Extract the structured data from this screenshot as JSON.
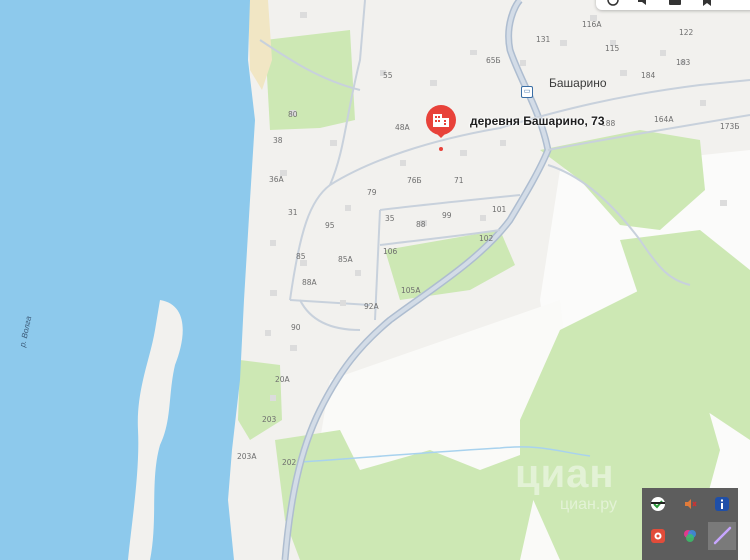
{
  "map": {
    "water_color": "#8dc9ec",
    "land_color": "#f2f1ee",
    "forest_color": "#cde8b4",
    "road_color": "#b9c6d6",
    "river_label": "р. Волга",
    "village_label": "Башарино",
    "marker": {
      "label": "деревня Башарино, 73",
      "color": "#e8423a",
      "icon": "building-icon"
    },
    "bus_stop_icon": "bus-stop-icon",
    "watermark": {
      "main": "циан",
      "sub": "циан.ру"
    },
    "house_numbers": [
      "116А",
      "131",
      "115",
      "122",
      "65Б",
      "55",
      "184",
      "183",
      "80",
      "48А",
      "188",
      "164А",
      "173Б",
      "38",
      "76Б",
      "71",
      "36А",
      "79",
      "31",
      "101",
      "95",
      "99",
      "85А",
      "35",
      "88",
      "106",
      "85",
      "102",
      "88А",
      "105А",
      "92А",
      "90",
      "20А",
      "203",
      "203А",
      "202"
    ]
  },
  "toolbar_top": {
    "icons": [
      "location-icon",
      "sound-icon",
      "screenshot-icon",
      "bookmark-icon"
    ]
  },
  "system_tray": {
    "icons": [
      "security-shield-icon",
      "volume-icon",
      "info-icon",
      "record-icon",
      "color-app-icon",
      "pen-icon"
    ]
  }
}
